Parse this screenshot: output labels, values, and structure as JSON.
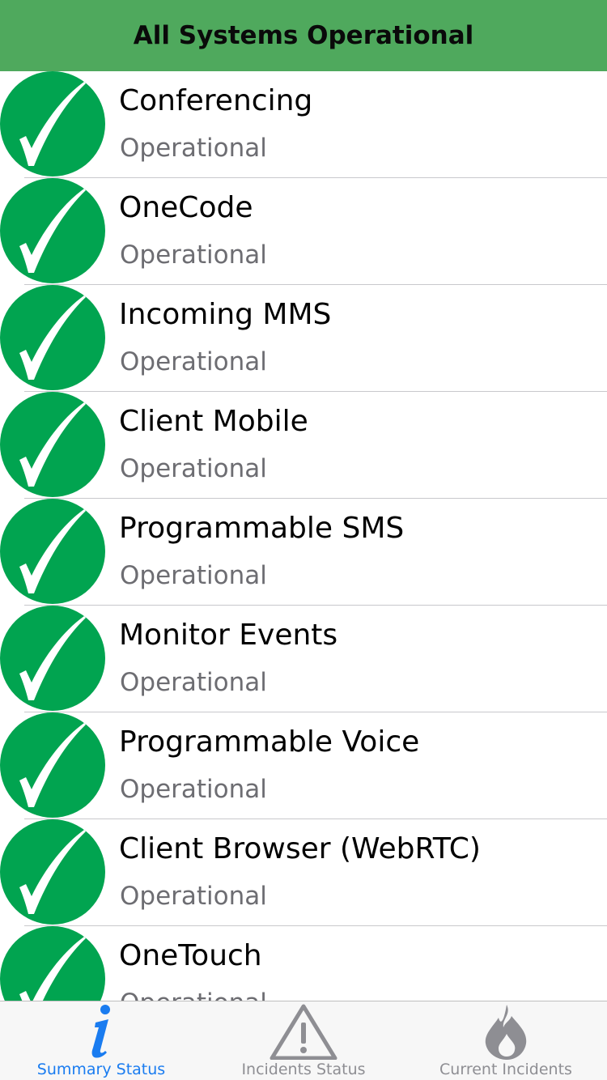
{
  "header": {
    "title": "All Systems Operational"
  },
  "services": [
    {
      "name": "Conferencing",
      "status": "Operational"
    },
    {
      "name": "OneCode",
      "status": "Operational"
    },
    {
      "name": "Incoming MMS",
      "status": "Operational"
    },
    {
      "name": "Client Mobile",
      "status": "Operational"
    },
    {
      "name": "Programmable SMS",
      "status": "Operational"
    },
    {
      "name": "Monitor Events",
      "status": "Operational"
    },
    {
      "name": "Programmable Voice",
      "status": "Operational"
    },
    {
      "name": "Client Browser (WebRTC)",
      "status": "Operational"
    },
    {
      "name": "OneTouch",
      "status": "Operational"
    }
  ],
  "status_icon": "check-circle-icon",
  "colors": {
    "banner": "#4fa95d",
    "operational": "#01a450",
    "tab_active": "#1a7cf0",
    "tab_inactive": "#8e8e93"
  },
  "tabbar": {
    "tabs": [
      {
        "label": "Summary Status",
        "icon": "info-icon",
        "active": true
      },
      {
        "label": "Incidents Status",
        "icon": "warning-icon",
        "active": false
      },
      {
        "label": "Current Incidents",
        "icon": "flame-icon",
        "active": false
      }
    ]
  }
}
